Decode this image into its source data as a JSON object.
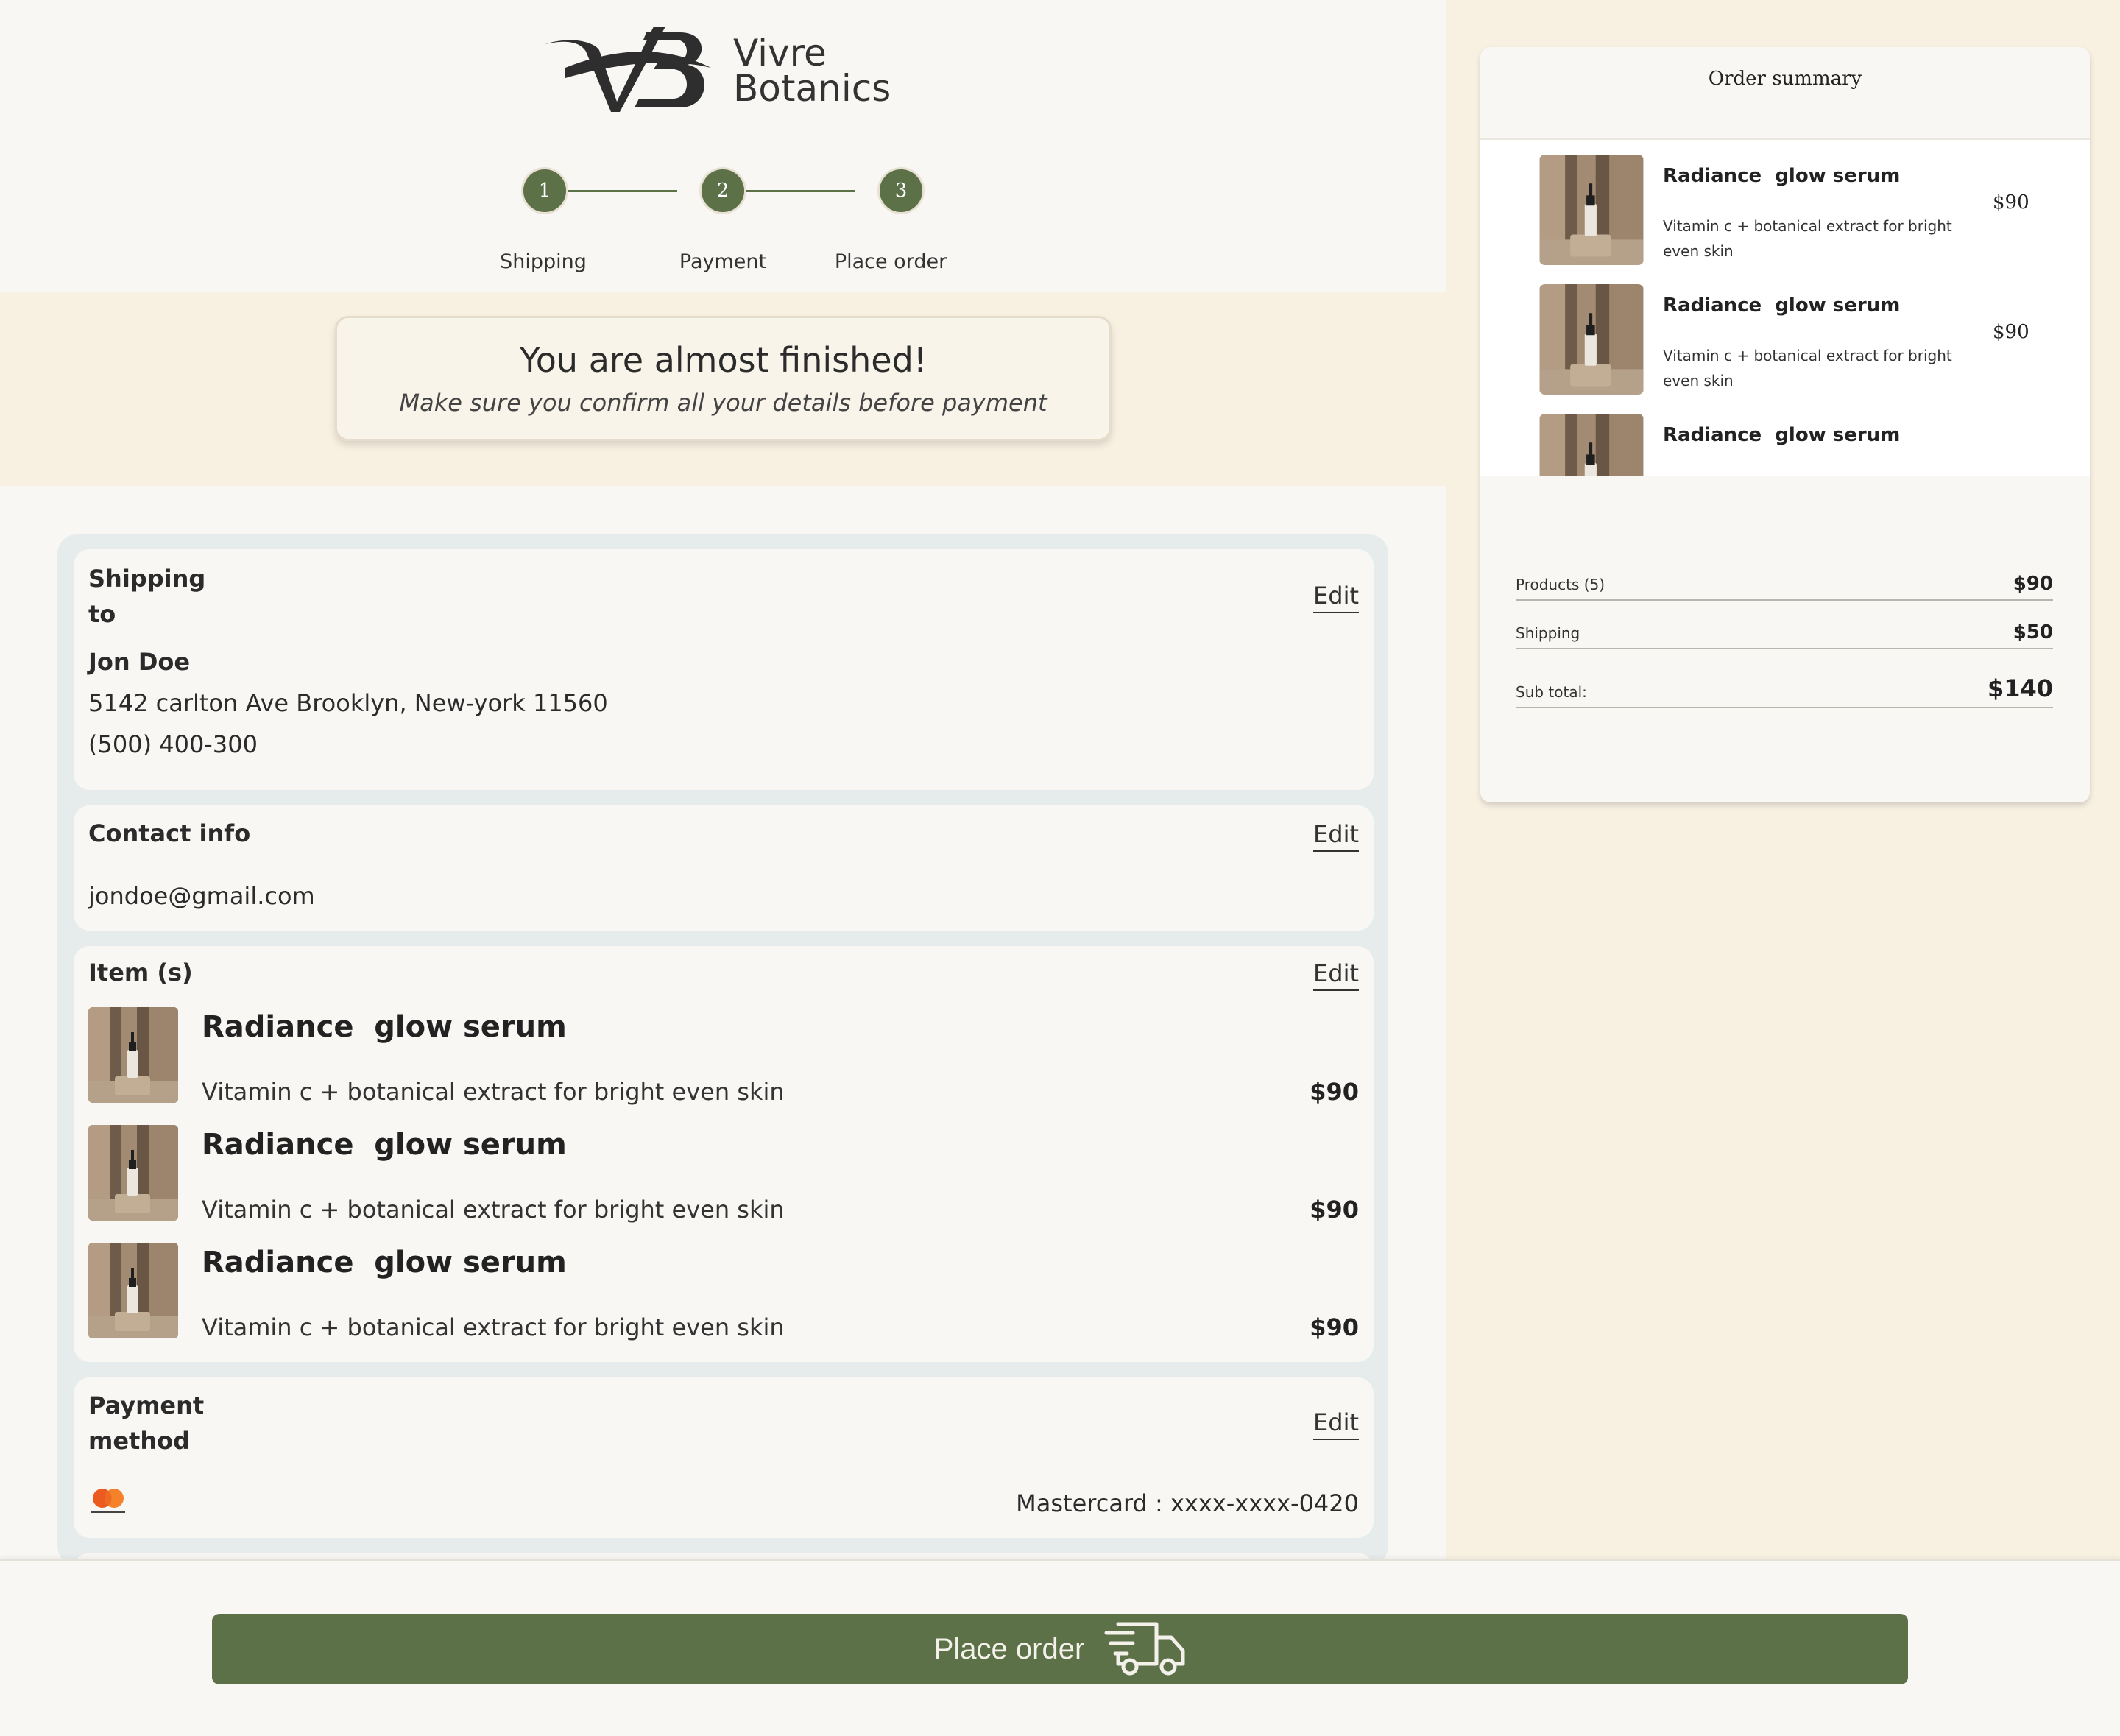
{
  "brand": {
    "monogram": "VB",
    "name_line1": "Vivre",
    "name_line2": "Botanics"
  },
  "steps": [
    {
      "number": "1",
      "label": "Shipping"
    },
    {
      "number": "2",
      "label": "Payment"
    },
    {
      "number": "3",
      "label": "Place order"
    }
  ],
  "banner": {
    "title": "You are almost finished!",
    "subtitle": "Make sure you confirm all your details before payment"
  },
  "shipping": {
    "title_line1": "Shipping",
    "title_line2": "to",
    "edit_label": "Edit",
    "name": "Jon Doe",
    "address": "5142 carlton Ave Brooklyn, New-york 11560",
    "phone": "(500) 400-300"
  },
  "contact": {
    "title": "Contact info",
    "edit_label": "Edit",
    "email": "jondoe@gmail.com"
  },
  "items": {
    "title": "Item (s)",
    "edit_label": "Edit",
    "list": [
      {
        "name": "Radiance  glow serum",
        "description": "Vitamin c + botanical extract for bright even skin",
        "price": "$90"
      },
      {
        "name": "Radiance  glow serum",
        "description": "Vitamin c + botanical extract for bright even skin",
        "price": "$90"
      },
      {
        "name": "Radiance  glow serum",
        "description": "Vitamin c + botanical extract for bright even skin",
        "price": "$90"
      }
    ]
  },
  "payment": {
    "title_line1": "Payment",
    "title_line2": "method",
    "edit_label": "Edit",
    "card_icon": "mastercard-icon",
    "card_text": "Mastercard : xxxx-xxxx-0420"
  },
  "summary": {
    "title": "Order summary",
    "items": [
      {
        "name": "Radiance  glow serum",
        "description": "Vitamin c + botanical extract for bright even skin",
        "price": "$90"
      },
      {
        "name": "Radiance  glow serum",
        "description": "Vitamin c + botanical extract for bright even skin",
        "price": "$90"
      },
      {
        "name": "Radiance  glow serum",
        "description": "",
        "price": ""
      }
    ],
    "products_label": "Products (5)",
    "products_value": "$90",
    "shipping_label": "Shipping",
    "shipping_value": "$50",
    "subtotal_label": "Sub total:",
    "subtotal_value": "$140"
  },
  "cta": {
    "label": "Place order",
    "icon": "delivery-truck-icon"
  },
  "colors": {
    "accent": "#5c7148",
    "background": "#f9f7f4",
    "cream": "#f8f0e1",
    "panel": "#e6ecec"
  }
}
